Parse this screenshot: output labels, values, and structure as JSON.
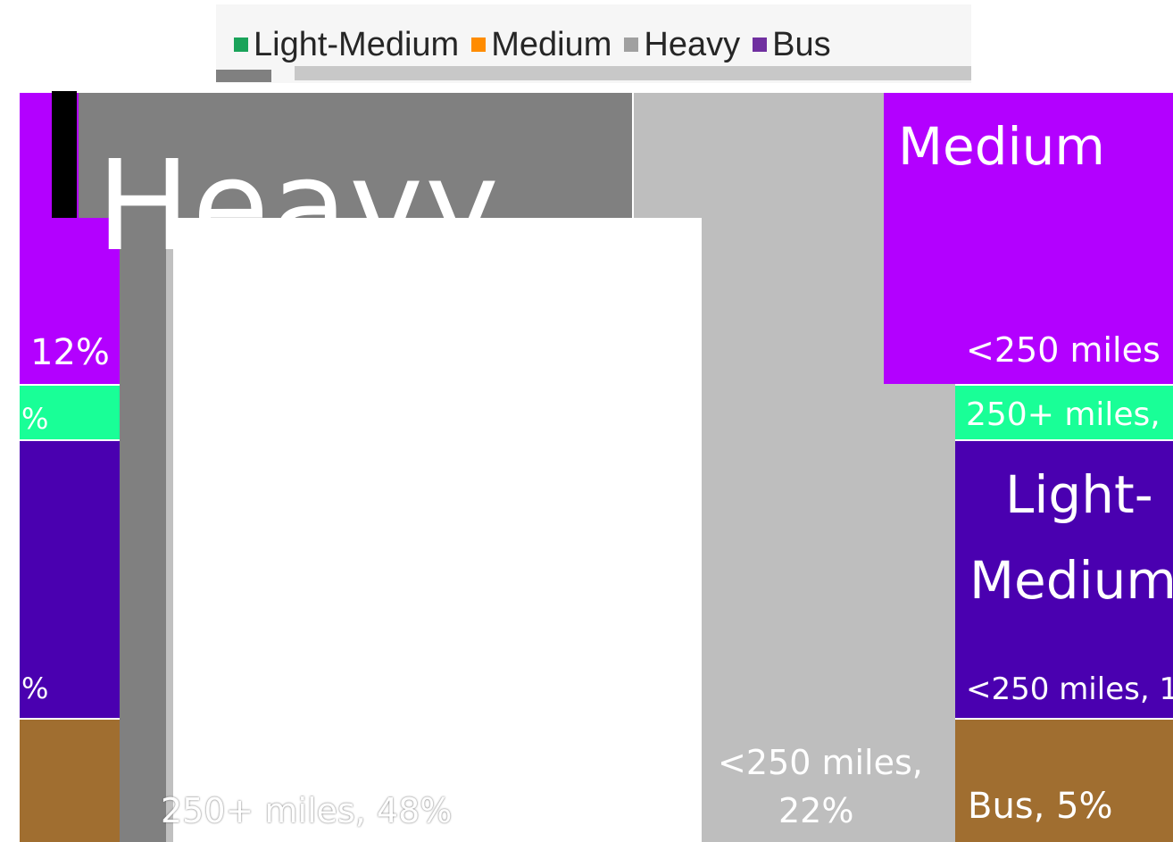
{
  "legend": [
    {
      "label": "Light-Medium",
      "color": "#1aa35a"
    },
    {
      "label": "Medium",
      "color": "#ff8c00"
    },
    {
      "label": "Heavy",
      "color": "#a0a0a0"
    },
    {
      "label": "Bus",
      "color": "#7030a0"
    }
  ],
  "colors": {
    "medium": "#b300ff",
    "medium_250plus": "#19ff97",
    "light_medium": "#4a00b0",
    "bus": "#a06e30",
    "heavy_dark": "#808080",
    "heavy_light": "#bebebe",
    "text": "#ffffff"
  },
  "labels": {
    "heavy_title": "Heavy",
    "heavy_250plus": "250+ miles, 48%",
    "heavy_lt250": "<250 miles,",
    "heavy_lt250_pct": "22%",
    "medium_title": "Medium",
    "medium_lt250": "<250 miles",
    "medium_250plus": "250+ miles,",
    "lightmed_title_1": "Light-",
    "lightmed_title_2": "Medium",
    "lightmed_lt250": "<250 miles, 1",
    "bus": "Bus, 5%",
    "left_12": "12%",
    "left_pct_a": "%",
    "left_pct_b": "%"
  },
  "chart_data": {
    "type": "treemap",
    "title": "",
    "legend": [
      "Light-Medium",
      "Medium",
      "Heavy",
      "Bus"
    ],
    "legend_position": "top",
    "nodes": [
      {
        "group": "Heavy",
        "label": "250+ miles",
        "value": 48
      },
      {
        "group": "Heavy",
        "label": "<250 miles",
        "value": 22
      },
      {
        "group": "Medium",
        "label": "<250 miles",
        "value": 12
      },
      {
        "group": "Medium",
        "label": "250+ miles",
        "value": null
      },
      {
        "group": "Light-Medium",
        "label": "<250 miles",
        "value": null
      },
      {
        "group": "Bus",
        "label": "Bus",
        "value": 5
      }
    ]
  }
}
